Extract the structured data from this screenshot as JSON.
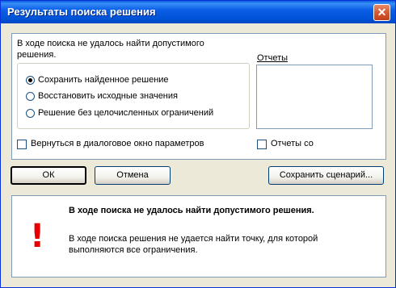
{
  "window": {
    "title": "Результаты поиска решения",
    "close_glyph": "✕"
  },
  "top_panel": {
    "message": "В ходе поиска не удалось найти допустимого",
    "message_line2": "решения.",
    "options": [
      {
        "label": "Сохранить найденное решение",
        "checked": true
      },
      {
        "label": "Восстановить исходные значения",
        "checked": false
      },
      {
        "label": "Решение без целочисленных ограничений",
        "checked": false
      }
    ],
    "reports_label": "Отчеты",
    "return_checkbox_label": "Вернуться в диалоговое окно параметров",
    "outline_checkbox_label": "Отчеты со"
  },
  "buttons": {
    "ok": "ОК",
    "cancel": "Отмена",
    "save_scenario": "Сохранить сценарий..."
  },
  "bottom_panel": {
    "heading": "В ходе поиска не удалось найти допустимого решения.",
    "body_line1": "В ходе поиска решения не удается найти точку, для которой",
    "body_line2": "выполняются все ограничения.",
    "icon": "exclamation-icon",
    "icon_glyph": "!"
  },
  "colors": {
    "title_bar": "#0052d6",
    "dialog_bg": "#ece9d8",
    "warning_icon": "#e60000"
  }
}
